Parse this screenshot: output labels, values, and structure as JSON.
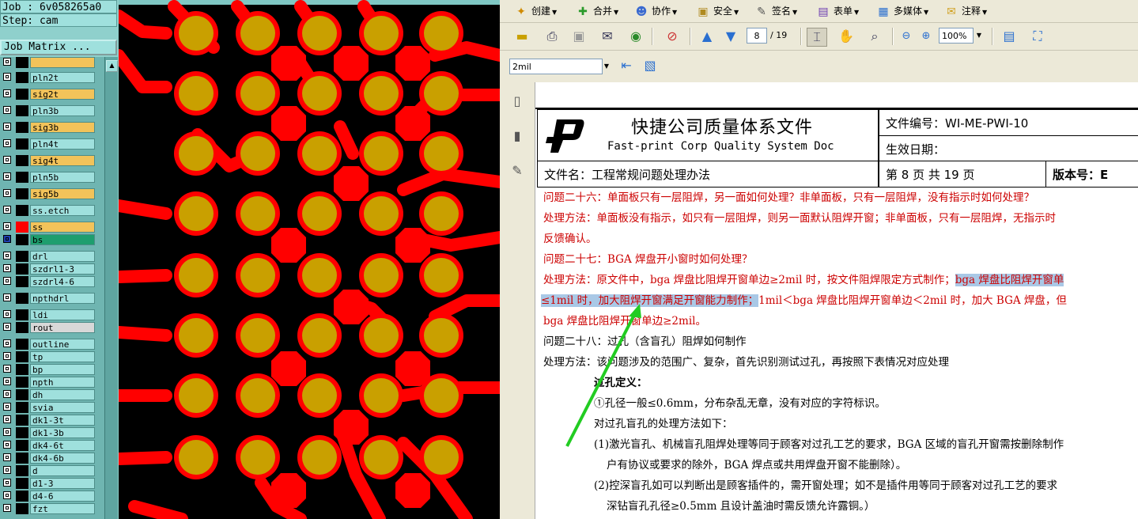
{
  "cam": {
    "job_label": "Job : 6v058265a0",
    "step_label": "Step: cam",
    "job_matrix_button": "Job Matrix ...",
    "layers": [
      {
        "name": "",
        "color": "#f2c35a",
        "active": true
      },
      {
        "name": "pln2t",
        "color": "#9fe0dd",
        "active": false
      },
      {
        "name": "sig2t",
        "color": "#f2c35a",
        "active": true
      },
      {
        "name": "pln3b",
        "color": "#9fe0dd",
        "active": false
      },
      {
        "name": "sig3b",
        "color": "#f2c35a",
        "active": true
      },
      {
        "name": "pln4t",
        "color": "#9fe0dd",
        "active": false
      },
      {
        "name": "sig4t",
        "color": "#f2c35a",
        "active": true
      },
      {
        "name": "pln5b",
        "color": "#9fe0dd",
        "active": false
      },
      {
        "name": "sig5b",
        "color": "#f2c35a",
        "active": true
      },
      {
        "name": "ss.etch",
        "color": "#9fe0dd",
        "active": false
      },
      {
        "name": "ss",
        "color": "#f2c35a",
        "active": true,
        "swatch": "#ff0000"
      },
      {
        "name": "bs",
        "color": "#1e9e6e",
        "active": true,
        "swatch": "#000000"
      },
      {
        "name": "drl",
        "color": "#9fe0dd",
        "active": false
      },
      {
        "name": "szdrl1-3",
        "color": "#9fe0dd",
        "active": false
      },
      {
        "name": "szdrl4-6",
        "color": "#9fe0dd",
        "active": false
      },
      {
        "name": "npthdrl",
        "color": "#9fe0dd",
        "active": false
      },
      {
        "name": "ldi",
        "color": "#9fe0dd",
        "active": false
      },
      {
        "name": "rout",
        "color": "#d8d8d8",
        "active": false
      },
      {
        "name": "outline",
        "color": "#9fe0dd",
        "active": false
      },
      {
        "name": "tp",
        "color": "#9fe0dd",
        "active": false
      },
      {
        "name": "bp",
        "color": "#9fe0dd",
        "active": false
      },
      {
        "name": "npth",
        "color": "#9fe0dd",
        "active": false
      },
      {
        "name": "dh",
        "color": "#9fe0dd",
        "active": false
      },
      {
        "name": "svia",
        "color": "#9fe0dd",
        "active": false
      },
      {
        "name": "dk1-3t",
        "color": "#9fe0dd",
        "active": false
      },
      {
        "name": "dk1-3b",
        "color": "#9fe0dd",
        "active": false
      },
      {
        "name": "dk4-6t",
        "color": "#9fe0dd",
        "active": false
      },
      {
        "name": "dk4-6b",
        "color": "#9fe0dd",
        "active": false
      },
      {
        "name": "d",
        "color": "#9fe0dd",
        "active": false
      },
      {
        "name": "d1-3",
        "color": "#9fe0dd",
        "active": false
      },
      {
        "name": "d4-6",
        "color": "#9fe0dd",
        "active": false
      },
      {
        "name": "fzt",
        "color": "#9fe0dd",
        "active": false
      }
    ]
  },
  "pcb": {
    "trace_color": "#ff0000",
    "pad_color": "#c9a000",
    "background": "#000000"
  },
  "pdf": {
    "menu": [
      {
        "label": "创建",
        "icon": "create-icon"
      },
      {
        "label": "合并",
        "icon": "merge-icon"
      },
      {
        "label": "协作",
        "icon": "collaborate-icon"
      },
      {
        "label": "安全",
        "icon": "lock-icon"
      },
      {
        "label": "签名",
        "icon": "pen-icon"
      },
      {
        "label": "表单",
        "icon": "form-icon"
      },
      {
        "label": "多媒体",
        "icon": "multimedia-icon"
      },
      {
        "label": "注释",
        "icon": "comment-icon"
      }
    ],
    "page_current": "8",
    "page_total": "/ 19",
    "zoom": "100%",
    "font_size_field": "2mil",
    "doc": {
      "company_title": "快捷公司质量体系文件",
      "company_subtitle": "Fast-print Corp Quality System Doc",
      "doc_number": "文件编号：WI-ME-PWI-10",
      "effective_date": "生效日期：",
      "file_name": "文件名：工程常规问题处理办法",
      "page_info": "第 8 页 共 19 页",
      "version": "版本号：E",
      "q26": "问题二十六：单面板只有一层阻焊，另一面如何处理？非单面板，只有一层阻焊，没有指示时如何处理？",
      "m26a": "处理方法：单面板没有指示，如只有一层阻焊，则另一面默认阻焊开窗；非单面板，只有一层阻焊，无指示时",
      "m26b": "反馈确认。",
      "q27": "问题二十七：BGA 焊盘开小窗时如何处理？",
      "m27a_plain": "处理方法：原文件中，bga 焊盘比阻焊开窗单边≥2mil 时，按文件阻焊限定方式制作；",
      "m27a_hl": "bga 焊盘比阻焊开窗单",
      "m27b_hl": "≤1mil 时，加大阻焊开窗满足开窗能力制作；",
      "m27b_plain": "1mil＜bga 焊盘比阻焊开窗单边＜2mil 时，加大 BGA 焊盘，但",
      "m27c": "bga 焊盘比阻焊开窗单边≥2mil。",
      "q28": "问题二十八：过孔（含盲孔）阻焊如何制作",
      "m28": "处理方法：该问题涉及的范围广、复杂，首先识别测试过孔，再按照下表情况对应处理",
      "via_def": "过孔定义：",
      "via_1": "①孔径一般≤0.6mm，分布杂乱无章，没有对应的字符标识。",
      "blind_title": "对过孔盲孔的处理方法如下：",
      "blind_1a": "(1)激光盲孔、机械盲孔阻焊处理等同于顾客对过孔工艺的要求，BGA 区域的盲孔开窗需按删除制作",
      "blind_1b": "户有协议或要求的除外，BGA 焊点或共用焊盘开窗不能删除）。",
      "blind_2a": "(2)控深盲孔如可以判断出是顾客插件的，需开窗处理；如不是插件用等同于顾客对过孔工艺的要求",
      "blind_2b": "深钻盲孔孔径≥0.5mm 且设计盖油时需反馈允许露铜。）"
    }
  },
  "annotation_arrow_color": "#22cc22"
}
